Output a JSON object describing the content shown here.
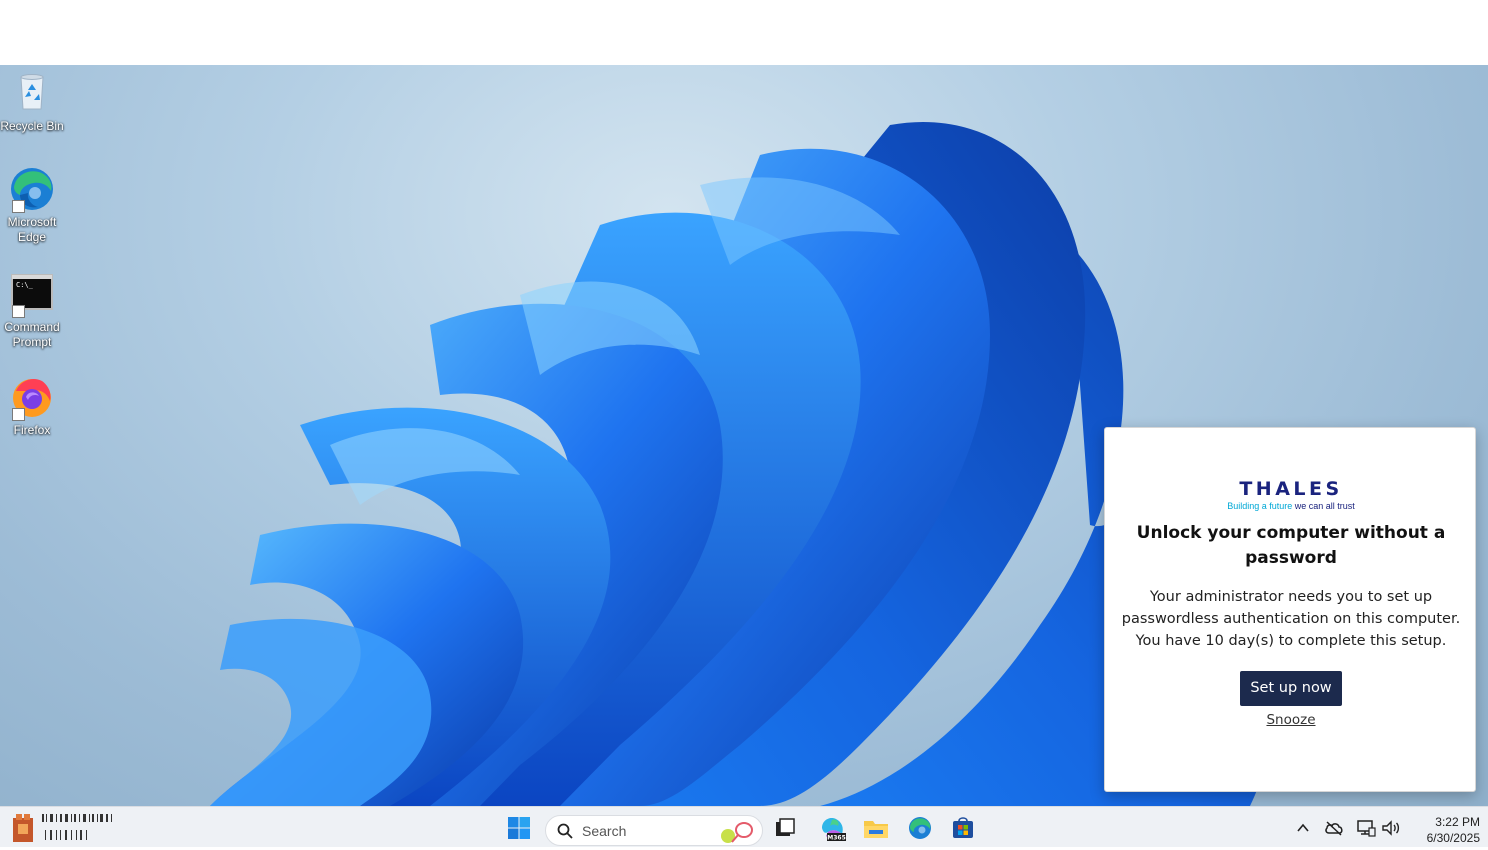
{
  "desktop": {
    "icons": [
      {
        "label": "Recycle Bin",
        "icon": "recycle-bin-icon"
      },
      {
        "label": "Microsoft Edge",
        "icon": "edge-icon"
      },
      {
        "label": "Command Prompt",
        "icon": "command-prompt-icon"
      },
      {
        "label": "Firefox",
        "icon": "firefox-icon"
      }
    ]
  },
  "popup": {
    "logo_word": "THALES",
    "logo_tagline_highlight": "Building a future",
    "logo_tagline_rest": " we can all trust",
    "title": "Unlock your computer without a password",
    "body": "Your administrator needs you to set up passwordless authentication on this computer. You have 10 day(s) to complete this setup.",
    "primary_button": "Set up now",
    "snooze_link": "Snooze",
    "colors": {
      "brand": "#1a237e",
      "accent": "#00a8d6",
      "button": "#1c2a4d"
    }
  },
  "taskbar": {
    "search_placeholder": "Search",
    "pinned": [
      "start-icon",
      "task-view-icon",
      "m365-copilot-icon",
      "file-explorer-icon",
      "edge-icon",
      "store-icon"
    ],
    "copilot_badge": "M365",
    "tray": [
      "chevron-up-icon",
      "onedrive-icon",
      "network-icon",
      "volume-icon"
    ],
    "time": "3:22 PM",
    "date": "6/30/2025"
  }
}
